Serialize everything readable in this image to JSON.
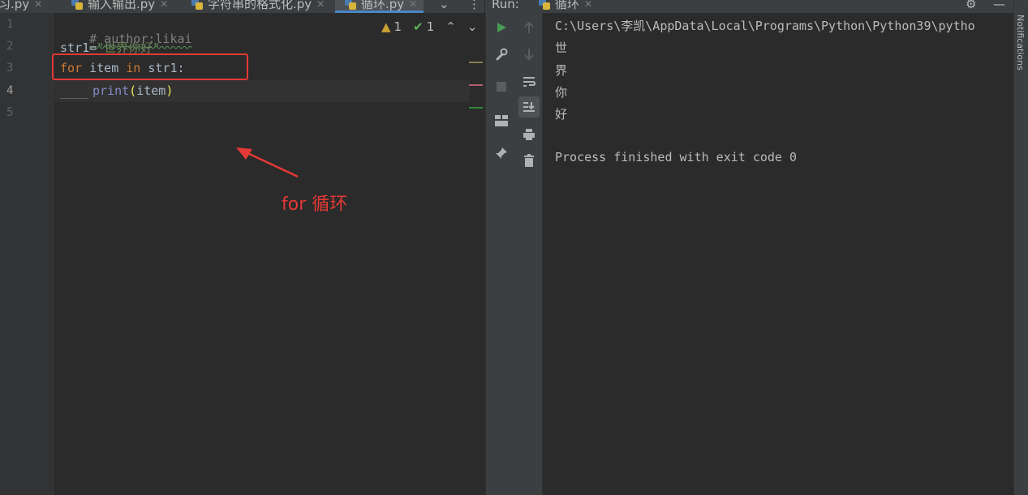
{
  "editor_tabs": [
    {
      "label": "习.py",
      "active": false
    },
    {
      "label": "输入输出.py",
      "active": false
    },
    {
      "label": "字符串的格式化.py",
      "active": false
    },
    {
      "label": "循环.py",
      "active": true
    }
  ],
  "run_panel": {
    "title": "Run:",
    "tab_label": "循环"
  },
  "editor": {
    "line_numbers": [
      "1",
      "2",
      "3",
      "4",
      "5"
    ],
    "line1_comment": "# author:likai",
    "line2_var": "str1=",
    "line2_string": "\"世界你好\"",
    "line3_for": "for",
    "line3_item": " item ",
    "line3_in": "in",
    "line3_rest": " str1:",
    "line4_fn": "print",
    "line4_open": "(",
    "line4_arg": "item",
    "line4_close": ")",
    "warnings_count": "1",
    "checks_count": "1"
  },
  "annotation": {
    "label": "for 循环",
    "color": "#e53935"
  },
  "console": {
    "command": "C:\\Users\\李凯\\AppData\\Local\\Programs\\Python\\Python39\\pytho",
    "outputs": [
      "世",
      "界",
      "你",
      "好"
    ],
    "exit_message": "Process finished with exit code 0"
  },
  "sidebar_right": {
    "notifications_label": "Notifications"
  },
  "colors": {
    "accent": "#4a88c7",
    "run_green": "#499c54",
    "keyword": "#cc7832",
    "string": "#6a8759"
  }
}
